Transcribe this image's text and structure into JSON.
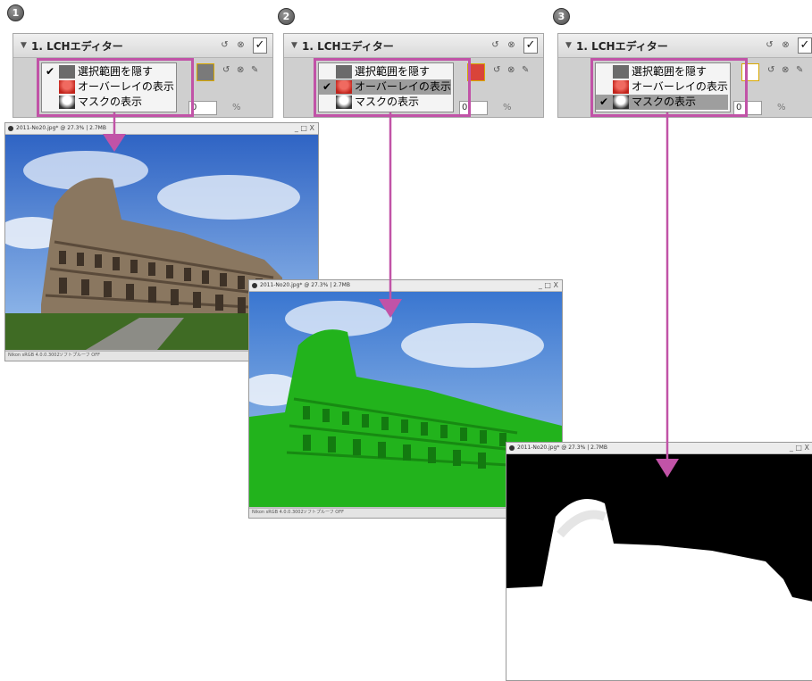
{
  "steps": [
    "1",
    "2",
    "3"
  ],
  "panel": {
    "title": "1. LCHエディター",
    "field_value": "0",
    "percent": "%"
  },
  "menu_items": [
    "選択範囲を隠す",
    "オーバーレイの表示",
    "マスクの表示"
  ],
  "menu_checks": [
    {
      "checked": "✔",
      "selected_index": 0
    },
    {
      "checked": "✔",
      "selected_index": 1
    },
    {
      "checked": "✔",
      "selected_index": 2
    }
  ],
  "image_window": {
    "title": "2011-No20.jpg* @ 27.3% | 2.7MB",
    "status_left": "Nikon sRGB 4.0.0.3002",
    "status_right": "ソフトプルーフ OFF",
    "controls": "_ □ X"
  },
  "colors": {
    "highlight": "#c153a7",
    "overlay": "#22b31c",
    "sky": "#5a8fd6",
    "mask_black": "#000000",
    "mask_white": "#ffffff"
  }
}
